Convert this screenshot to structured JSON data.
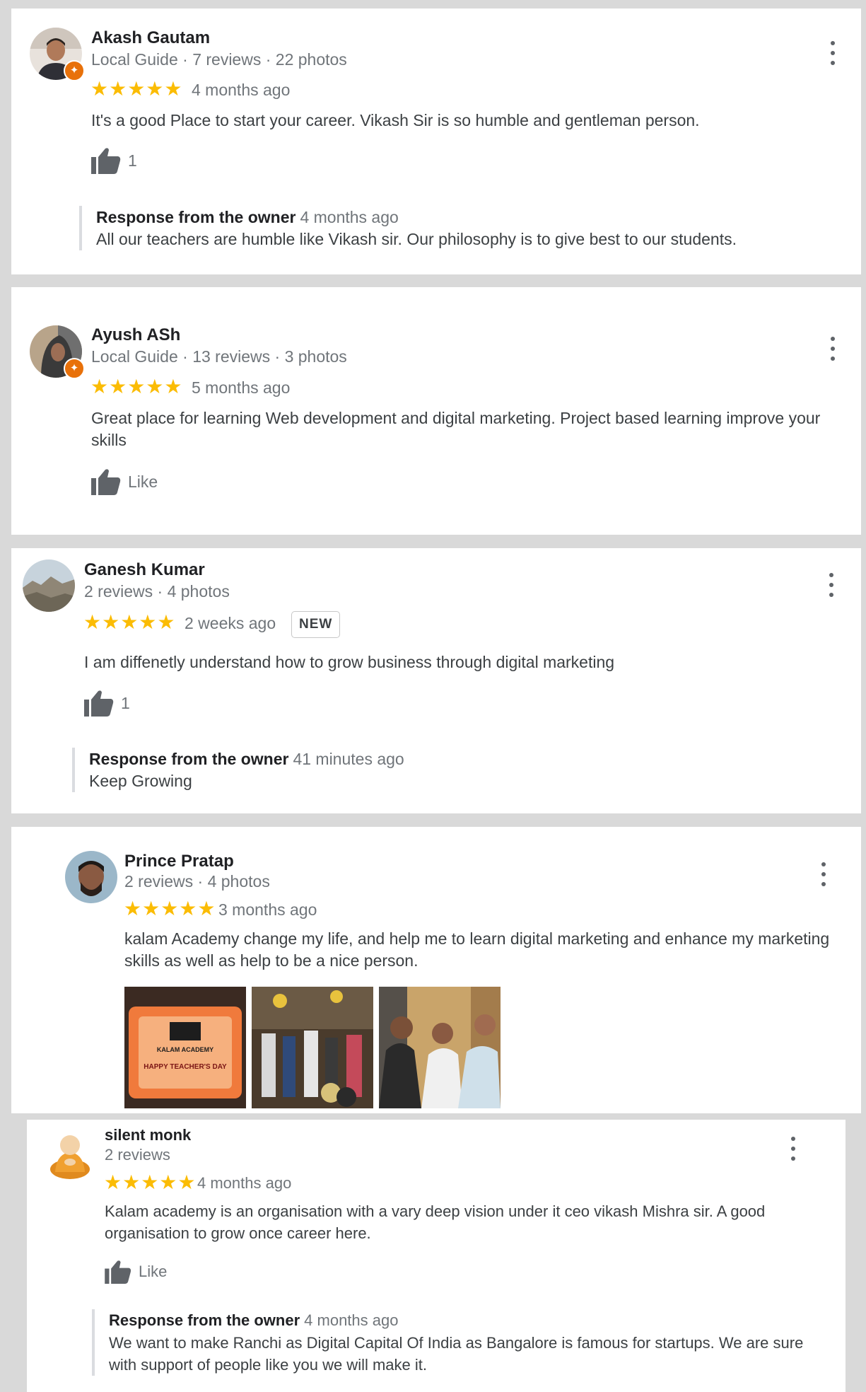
{
  "reviews": [
    {
      "name": "Akash Gautam",
      "meta": "Local Guide · 7 reviews · 22 photos",
      "stars": "★★★★★",
      "when": "4 months ago",
      "text": "It's a good Place to start your career. Vikash Sir is so humble and gentleman person.",
      "likes": "1",
      "response": {
        "label": "Response from the owner",
        "when": "4 months ago",
        "text": "All our teachers are humble like Vikash sir. Our philosophy is to give best to our students."
      }
    },
    {
      "name": "Ayush ASh",
      "meta": "Local Guide · 13 reviews · 3 photos",
      "stars": "★★★★★",
      "when": "5 months ago",
      "text": "Great place for learning Web development and digital marketing. Project based learning improve your skills",
      "likes": "Like"
    },
    {
      "name": "Ganesh Kumar",
      "meta": "2 reviews · 4 photos",
      "stars": "★★★★★",
      "when": "2 weeks ago",
      "badge": "NEW",
      "text": "I am diffenetly understand how to grow business through digital marketing",
      "likes": "1",
      "response": {
        "label": "Response from the owner",
        "when": "41 minutes ago",
        "text": "Keep Growing"
      }
    },
    {
      "name": "Prince Pratap",
      "meta": "2 reviews · 4 photos",
      "stars": "★★★★★",
      "when": "3 months ago",
      "text": "kalam Academy change my life, and help me to learn digital marketing and enhance my marketing skills as well as help to be a nice person.",
      "photos": [
        {
          "caption": "KALAM ACADEMY",
          "subcaption": "HAPPY TEACHER'S DAY"
        },
        {
          "caption": ""
        },
        {
          "caption": ""
        }
      ]
    },
    {
      "name": "silent monk",
      "meta": "2 reviews",
      "stars": "★★★★★",
      "when": "4 months ago",
      "text": "Kalam academy is an organisation with a vary deep vision under it ceo vikash Mishra sir. A good organisation to grow once career here.",
      "likes": "Like",
      "response": {
        "label": "Response from the owner",
        "when": "4 months ago",
        "text": "We want to make Ranchi as Digital Capital Of India as Bangalore is famous for startups. We are sure with support of people like you we will make it."
      }
    }
  ],
  "icons": {
    "thumb": "thumbs-up-icon",
    "more": "more-vert-icon",
    "guide": "local-guide-star-icon"
  },
  "colors": {
    "star": "#fbbc04",
    "guide_badge": "#e8710a",
    "background": "#d9d9d9"
  }
}
